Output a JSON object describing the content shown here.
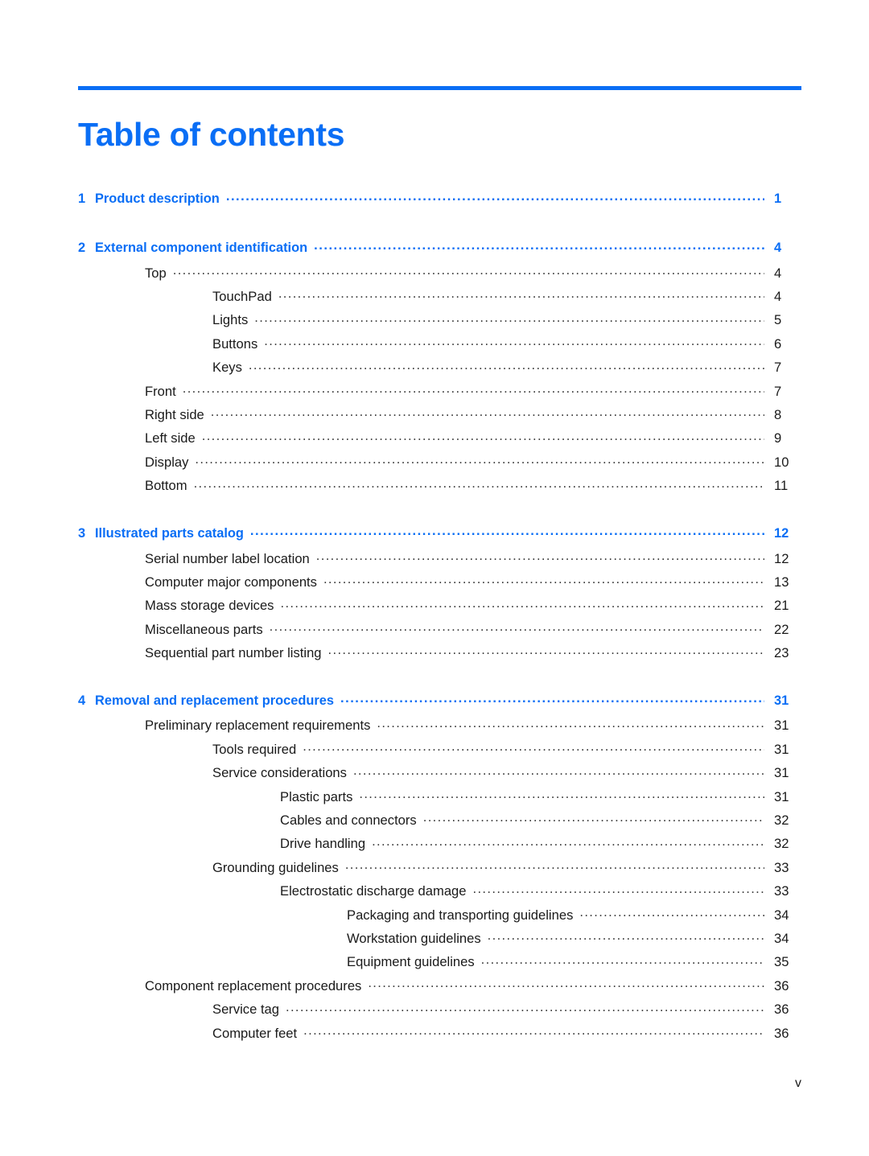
{
  "document": {
    "title": "Table of contents",
    "accent_color": "#0a6ef5",
    "text_color": "#1a1a1a",
    "folio": "v"
  },
  "toc": {
    "entries": [
      {
        "level": 1,
        "number": "1",
        "label": "Product description",
        "page": "1",
        "gap_before": false
      },
      {
        "level": 1,
        "number": "2",
        "label": "External component identification",
        "page": "4",
        "gap_before": true
      },
      {
        "level": 2,
        "number": "",
        "label": "Top",
        "page": "4",
        "gap_before": false
      },
      {
        "level": 3,
        "number": "",
        "label": "TouchPad",
        "page": "4",
        "gap_before": false
      },
      {
        "level": 3,
        "number": "",
        "label": "Lights",
        "page": "5",
        "gap_before": false
      },
      {
        "level": 3,
        "number": "",
        "label": "Buttons",
        "page": "6",
        "gap_before": false
      },
      {
        "level": 3,
        "number": "",
        "label": "Keys",
        "page": "7",
        "gap_before": false
      },
      {
        "level": 2,
        "number": "",
        "label": "Front",
        "page": "7",
        "gap_before": false
      },
      {
        "level": 2,
        "number": "",
        "label": "Right side",
        "page": "8",
        "gap_before": false
      },
      {
        "level": 2,
        "number": "",
        "label": "Left side",
        "page": "9",
        "gap_before": false
      },
      {
        "level": 2,
        "number": "",
        "label": "Display",
        "page": "10",
        "gap_before": false
      },
      {
        "level": 2,
        "number": "",
        "label": "Bottom",
        "page": "11",
        "gap_before": false
      },
      {
        "level": 1,
        "number": "3",
        "label": "Illustrated parts catalog",
        "page": "12",
        "gap_before": true
      },
      {
        "level": 2,
        "number": "",
        "label": "Serial number label location",
        "page": "12",
        "gap_before": false
      },
      {
        "level": 2,
        "number": "",
        "label": "Computer major components",
        "page": "13",
        "gap_before": false
      },
      {
        "level": 2,
        "number": "",
        "label": "Mass storage devices",
        "page": "21",
        "gap_before": false
      },
      {
        "level": 2,
        "number": "",
        "label": "Miscellaneous parts",
        "page": "22",
        "gap_before": false
      },
      {
        "level": 2,
        "number": "",
        "label": "Sequential part number listing",
        "page": "23",
        "gap_before": false
      },
      {
        "level": 1,
        "number": "4",
        "label": "Removal and replacement procedures",
        "page": "31",
        "gap_before": true
      },
      {
        "level": 2,
        "number": "",
        "label": "Preliminary replacement requirements",
        "page": "31",
        "gap_before": false
      },
      {
        "level": 3,
        "number": "",
        "label": "Tools required",
        "page": "31",
        "gap_before": false
      },
      {
        "level": 3,
        "number": "",
        "label": "Service considerations",
        "page": "31",
        "gap_before": false
      },
      {
        "level": 4,
        "number": "",
        "label": "Plastic parts",
        "page": "31",
        "gap_before": false
      },
      {
        "level": 4,
        "number": "",
        "label": "Cables and connectors",
        "page": "32",
        "gap_before": false
      },
      {
        "level": 4,
        "number": "",
        "label": "Drive handling",
        "page": "32",
        "gap_before": false
      },
      {
        "level": 3,
        "number": "",
        "label": "Grounding guidelines",
        "page": "33",
        "gap_before": false
      },
      {
        "level": 4,
        "number": "",
        "label": "Electrostatic discharge damage",
        "page": "33",
        "gap_before": false
      },
      {
        "level": 5,
        "number": "",
        "label": "Packaging and transporting guidelines",
        "page": "34",
        "gap_before": false
      },
      {
        "level": 5,
        "number": "",
        "label": "Workstation guidelines",
        "page": "34",
        "gap_before": false
      },
      {
        "level": 5,
        "number": "",
        "label": "Equipment guidelines",
        "page": "35",
        "gap_before": false
      },
      {
        "level": 2,
        "number": "",
        "label": "Component replacement procedures",
        "page": "36",
        "gap_before": false
      },
      {
        "level": 3,
        "number": "",
        "label": "Service tag",
        "page": "36",
        "gap_before": false
      },
      {
        "level": 3,
        "number": "",
        "label": "Computer feet",
        "page": "36",
        "gap_before": false
      }
    ]
  }
}
